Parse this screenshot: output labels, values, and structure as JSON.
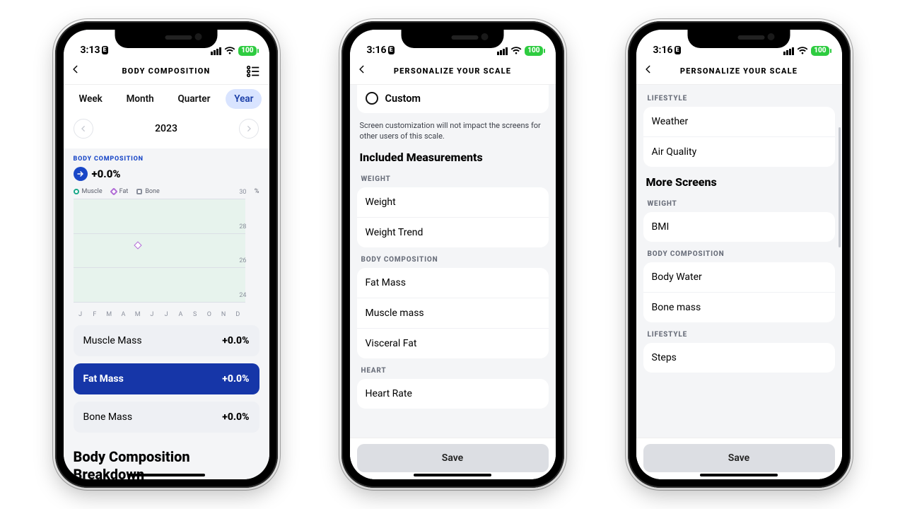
{
  "status_battery": "100",
  "screens": [
    {
      "time": "3:13",
      "title": "BODY COMPOSITION",
      "has_menu_icon": true,
      "tabs": [
        "Week",
        "Month",
        "Quarter",
        "Year"
      ],
      "active_tab": "Year",
      "year": "2023",
      "section_label": "BODY COMPOSITION",
      "delta": "+0.0%",
      "legend": {
        "muscle": "Muscle",
        "fat": "Fat",
        "bone": "Bone",
        "unit": "%"
      },
      "metrics": [
        {
          "name": "Muscle Mass",
          "value": "+0.0%",
          "selected": false
        },
        {
          "name": "Fat Mass",
          "value": "+0.0%",
          "selected": true
        },
        {
          "name": "Bone Mass",
          "value": "+0.0%",
          "selected": false
        }
      ],
      "breakdown_heading": "Body Composition Breakdown"
    },
    {
      "time": "3:16",
      "title": "PERSONALIZE YOUR SCALE",
      "radio_label": "Custom",
      "helper": "Screen customization will not impact the screens for other users of this scale.",
      "section_h": "Included Measurements",
      "groups": [
        {
          "label": "WEIGHT",
          "items": [
            "Weight",
            "Weight Trend"
          ]
        },
        {
          "label": "BODY COMPOSITION",
          "items": [
            "Fat Mass",
            "Muscle mass",
            "Visceral Fat"
          ]
        },
        {
          "label": "HEART",
          "items": [
            "Heart Rate"
          ]
        }
      ],
      "save": "Save"
    },
    {
      "time": "3:16",
      "title": "PERSONALIZE YOUR SCALE",
      "top_group": {
        "label": "LIFESTYLE",
        "items": [
          "Weather",
          "Air Quality"
        ]
      },
      "section_h": "More Screens",
      "groups": [
        {
          "label": "WEIGHT",
          "items": [
            "BMI"
          ]
        },
        {
          "label": "BODY COMPOSITION",
          "items": [
            "Body Water",
            "Bone mass"
          ]
        },
        {
          "label": "LIFESTYLE",
          "items": [
            "Steps"
          ]
        }
      ],
      "save": "Save"
    }
  ],
  "chart_data": {
    "type": "line",
    "title": "Body Composition",
    "xlabel": "",
    "ylabel": "%",
    "categories": [
      "J",
      "F",
      "M",
      "A",
      "M",
      "J",
      "J",
      "A",
      "S",
      "O",
      "N",
      "D"
    ],
    "ylim": [
      24,
      30
    ],
    "yticks": [
      24,
      26,
      28,
      30
    ],
    "series": [
      {
        "name": "Muscle",
        "values": [
          null,
          null,
          null,
          null,
          null,
          null,
          null,
          null,
          null,
          null,
          null,
          null
        ]
      },
      {
        "name": "Fat",
        "values": [
          null,
          null,
          null,
          null,
          27,
          null,
          null,
          null,
          null,
          null,
          null,
          null
        ]
      },
      {
        "name": "Bone",
        "values": [
          null,
          null,
          null,
          null,
          null,
          null,
          null,
          null,
          null,
          null,
          null,
          null
        ]
      }
    ],
    "legend_position": "top"
  }
}
